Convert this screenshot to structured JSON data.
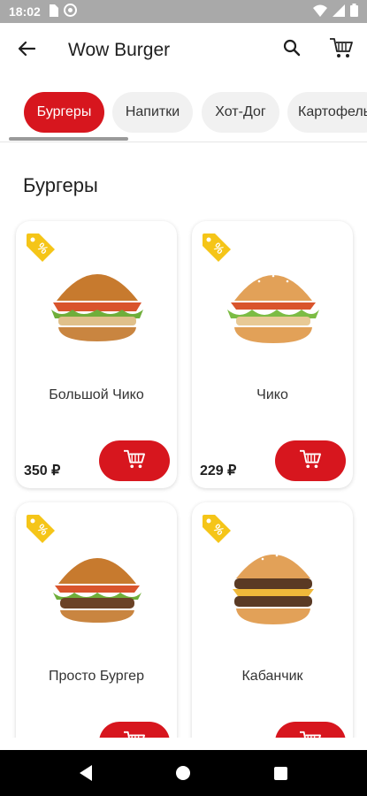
{
  "status_bar": {
    "time": "18:02"
  },
  "app_bar": {
    "title": "Wow Burger"
  },
  "tabs": [
    {
      "label": "Бургеры",
      "active": true
    },
    {
      "label": "Напитки",
      "active": false
    },
    {
      "label": "Хот-Дог",
      "active": false
    },
    {
      "label": "Картофель",
      "active": false
    }
  ],
  "section": {
    "title": "Бургеры"
  },
  "products": [
    {
      "name": "Большой Чико",
      "price": "350 ₽"
    },
    {
      "name": "Чико",
      "price": "229 ₽"
    },
    {
      "name": "Просто Бургер",
      "price": ""
    },
    {
      "name": "Кабанчик",
      "price": ""
    }
  ],
  "colors": {
    "accent": "#d7161e",
    "badge": "#f5c518",
    "statusbar": "#a9a9a9"
  },
  "icons": {
    "back": "arrow-left-icon",
    "search": "search-icon",
    "cart": "shopping-cart-icon",
    "badge": "discount-percent-tag-icon",
    "add_to_cart": "shopping-cart-icon"
  }
}
